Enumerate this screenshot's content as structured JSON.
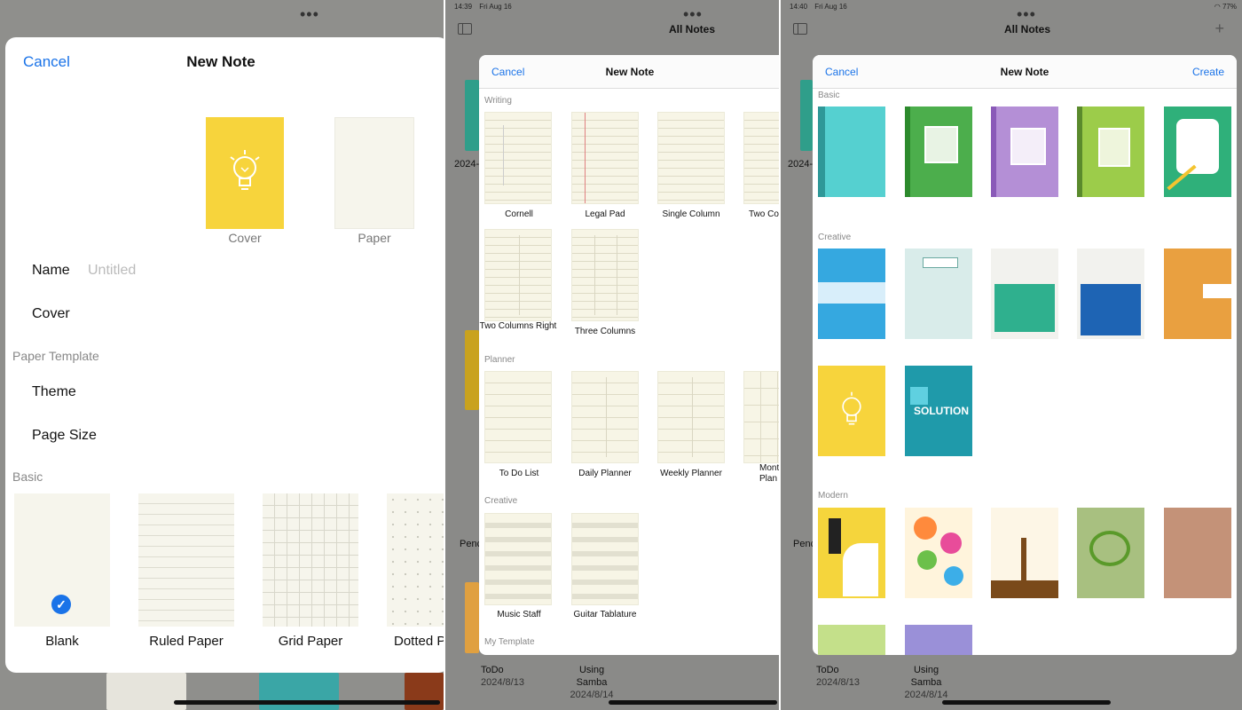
{
  "panel1": {
    "modal": {
      "cancel_label": "Cancel",
      "title": "New Note",
      "cover_thumb_label": "Cover",
      "paper_thumb_label": "Paper",
      "name_label": "Name",
      "name_placeholder": "Untitled",
      "cover_row_label": "Cover",
      "paper_template_header": "Paper Template",
      "theme_label": "Theme",
      "page_size_label": "Page Size",
      "basic_header": "Basic",
      "papers": [
        {
          "label": "Blank",
          "selected": true
        },
        {
          "label": "Ruled Paper",
          "selected": false
        },
        {
          "label": "Grid Paper",
          "selected": false
        },
        {
          "label": "Dotted P",
          "selected": false
        }
      ]
    }
  },
  "panel2": {
    "status": {
      "time": "14:39",
      "date": "Fri Aug 16"
    },
    "bg_title": "All Notes",
    "bg_notes": [
      {
        "title": "ToDo",
        "date": "2024/8/13"
      },
      {
        "title": "Using Samba",
        "date": "2024/8/14"
      }
    ],
    "bg_side_labels": [
      "2024-",
      "Penc"
    ],
    "modal": {
      "cancel_label": "Cancel",
      "title": "New Note",
      "sections": {
        "writing": "Writing",
        "planner": "Planner",
        "creative": "Creative",
        "my_template": "My Template"
      },
      "writing_items": [
        "Cornell",
        "Legal Pad",
        "Single Column",
        "Two Co",
        "Two Columns Right",
        "Three Columns"
      ],
      "planner_items": [
        "To Do List",
        "Daily Planner",
        "Weekly Planner",
        "Mont Plan"
      ],
      "creative_items": [
        "Music Staff",
        "Guitar Tablature"
      ]
    }
  },
  "panel3": {
    "status": {
      "time": "14:40",
      "date": "Fri Aug 16",
      "battery": "77%"
    },
    "bg_title": "All Notes",
    "bg_notes": [
      {
        "title": "ToDo",
        "date": "2024/8/13"
      },
      {
        "title": "Using Samba",
        "date": "2024/8/14"
      }
    ],
    "bg_side_labels": [
      "2024-",
      "Penc"
    ],
    "modal": {
      "cancel_label": "Cancel",
      "title": "New Note",
      "create_label": "Create",
      "sections": {
        "basic": "Basic",
        "creative": "Creative",
        "modern": "Modern"
      },
      "solution_text": "SOLUTION"
    }
  },
  "colors": {
    "accent": "#1a73e8",
    "cover_yellow": "#f7d43c",
    "paper": "#f6f5ec"
  }
}
